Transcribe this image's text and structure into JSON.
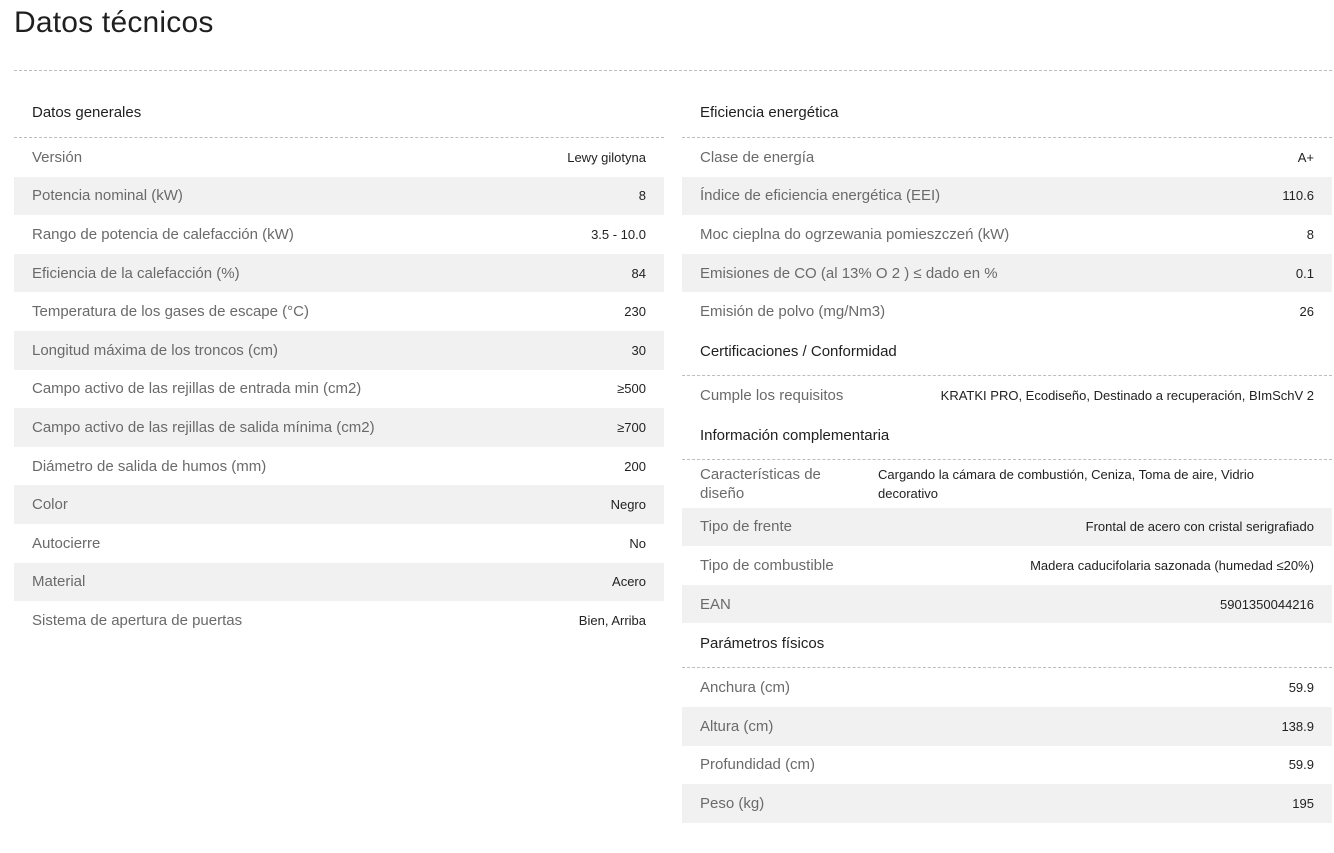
{
  "page": {
    "title": "Datos técnicos"
  },
  "left": {
    "sections": [
      {
        "title": "Datos generales",
        "rows": [
          {
            "label": "Versión",
            "value": "Lewy gilotyna"
          },
          {
            "label": "Potencia nominal (kW)",
            "value": "8"
          },
          {
            "label": "Rango de potencia de calefacción (kW)",
            "value": "3.5 - 10.0"
          },
          {
            "label": "Eficiencia de la calefacción (%)",
            "value": "84"
          },
          {
            "label": "Temperatura de los gases de escape (°C)",
            "value": "230"
          },
          {
            "label": "Longitud máxima de los troncos (cm)",
            "value": "30"
          },
          {
            "label": "Campo activo de las rejillas de entrada min (cm2)",
            "value": "≥500"
          },
          {
            "label": "Campo activo de las rejillas de salida mínima (cm2)",
            "value": "≥700"
          },
          {
            "label": "Diámetro de salida de humos (mm)",
            "value": "200"
          },
          {
            "label": "Color",
            "value": "Negro"
          },
          {
            "label": "Autocierre",
            "value": "No"
          },
          {
            "label": "Material",
            "value": "Acero"
          },
          {
            "label": "Sistema de apertura de puertas",
            "value": "Bien, Arriba"
          }
        ]
      }
    ]
  },
  "right": {
    "sections": [
      {
        "title": "Eficiencia energética",
        "rows": [
          {
            "label": "Clase de energía",
            "value": "A+"
          },
          {
            "label": "Índice de eficiencia energética (EEI)",
            "value": "110.6"
          },
          {
            "label": "Moc cieplna do ogrzewania pomieszczeń (kW)",
            "value": "8"
          },
          {
            "label": "Emisiones de CO (al 13% O 2 ) ≤ dado en %",
            "value": "0.1"
          },
          {
            "label": "Emisión de polvo (mg/Nm3)",
            "value": "26"
          }
        ]
      },
      {
        "title": "Certificaciones / Conformidad",
        "rows": [
          {
            "label": "Cumple los requisitos",
            "value": "KRATKI PRO, Ecodiseño, Destinado a recuperación, BImSchV 2"
          }
        ]
      },
      {
        "title": "Información complementaria",
        "rows": [
          {
            "label": "Características de diseño",
            "value": "Cargando la cámara de combustión, Ceniza, Toma de aire, Vidrio decorativo"
          },
          {
            "label": "Tipo de frente",
            "value": "Frontal de acero con cristal serigrafiado"
          },
          {
            "label": "Tipo de combustible",
            "value": "Madera caducifolaria sazonada (humedad ≤20%)"
          },
          {
            "label": "EAN",
            "value": "5901350044216"
          }
        ]
      },
      {
        "title": "Parámetros físicos",
        "rows": [
          {
            "label": "Anchura (cm)",
            "value": "59.9"
          },
          {
            "label": "Altura (cm)",
            "value": "138.9"
          },
          {
            "label": "Profundidad (cm)",
            "value": "59.9"
          },
          {
            "label": "Peso (kg)",
            "value": "195"
          }
        ]
      }
    ]
  }
}
